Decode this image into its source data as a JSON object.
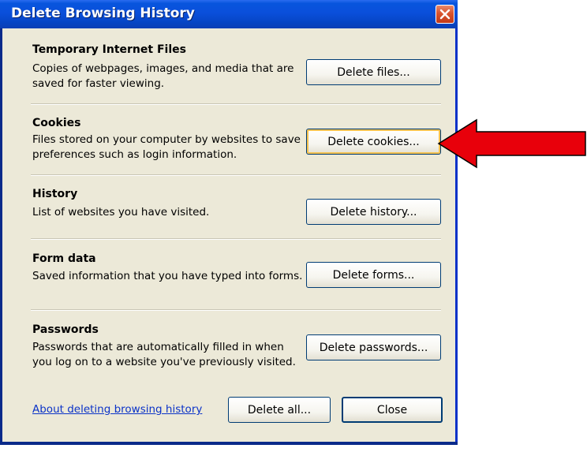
{
  "window": {
    "title": "Delete Browsing History",
    "close_icon": "close-icon"
  },
  "sections": [
    {
      "title": "Temporary Internet Files",
      "description": "Copies of webpages, images, and media that are saved for faster viewing.",
      "button_label": "Delete files..."
    },
    {
      "title": "Cookies",
      "description": "Files stored on your computer by websites to save preferences such as login information.",
      "button_label": "Delete cookies..."
    },
    {
      "title": "History",
      "description": "List of websites you have visited.",
      "button_label": "Delete history..."
    },
    {
      "title": "Form data",
      "description": "Saved information that you have typed into forms.",
      "button_label": "Delete forms..."
    },
    {
      "title": "Passwords",
      "description": "Passwords that are automatically filled in when you log on to a website you've previously visited.",
      "button_label": "Delete passwords..."
    }
  ],
  "footer": {
    "about_link": "About deleting browsing history",
    "delete_all_label": "Delete all...",
    "close_label": "Close"
  },
  "annotation": {
    "arrow_icon": "red-arrow-icon",
    "arrow_color": "#e8000b"
  },
  "colors": {
    "titlebar": "#0a4fdb",
    "window_bg": "#ece9d8",
    "link": "#0b33c8"
  }
}
